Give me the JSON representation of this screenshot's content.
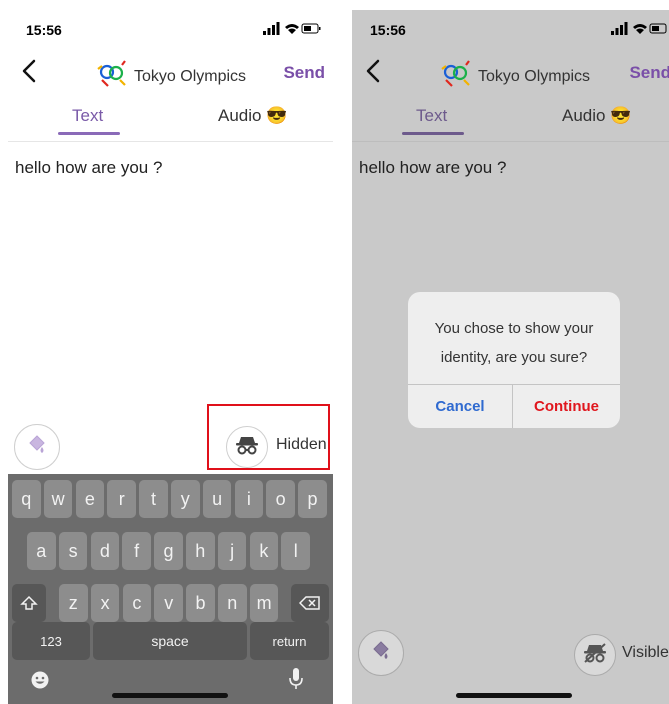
{
  "left": {
    "status": {
      "time": "15:56"
    },
    "nav": {
      "title": "Tokyo Olympics",
      "send": "Send"
    },
    "tabs": {
      "text": "Text",
      "audio": "Audio 😎"
    },
    "message": "hello how are you ?",
    "identity": {
      "label": "Hidden"
    },
    "keyboard": {
      "row1": [
        "q",
        "w",
        "e",
        "r",
        "t",
        "y",
        "u",
        "i",
        "o",
        "p"
      ],
      "row2": [
        "a",
        "s",
        "d",
        "f",
        "g",
        "h",
        "j",
        "k",
        "l"
      ],
      "row3": [
        "z",
        "x",
        "c",
        "v",
        "b",
        "n",
        "m"
      ],
      "numbers": "123",
      "space": "space",
      "return": "return"
    }
  },
  "right": {
    "status": {
      "time": "15:56"
    },
    "nav": {
      "title": "Tokyo Olympics",
      "send": "Send"
    },
    "tabs": {
      "text": "Text",
      "audio": "Audio 😎"
    },
    "message": "hello how are you ?",
    "dialog": {
      "message": "You chose to show your identity, are you sure?",
      "cancel": "Cancel",
      "continue": "Continue"
    },
    "identity": {
      "label": "Visible"
    }
  },
  "colors": {
    "accent": "#7a4fa8",
    "highlight": "#e0101a",
    "dialog_confirm": "#e0161e",
    "dialog_cancel": "#2f6ad0"
  }
}
